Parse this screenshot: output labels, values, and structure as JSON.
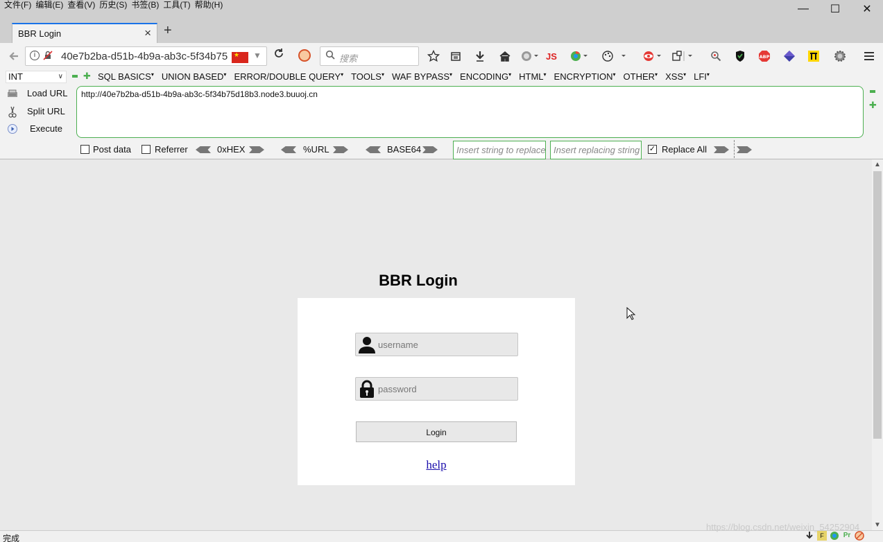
{
  "menubar": {
    "items": [
      "文件(F)",
      "编辑(E)",
      "查看(V)",
      "历史(S)",
      "书签(B)",
      "工具(T)",
      "帮助(H)"
    ]
  },
  "window": {
    "minimize": "—",
    "maximize": "☐",
    "close": "✕"
  },
  "tab": {
    "title": "BBR Login",
    "close": "×",
    "new_tab": "+"
  },
  "navbar": {
    "url": "40e7b2ba-d51b-4b9a-ab3c-5f34b75",
    "search_placeholder": "搜索",
    "icons": [
      "star-icon",
      "reader-icon",
      "download-icon",
      "home-icon",
      "earth-icon",
      "js-icon",
      "chrome-icon",
      "palette-icon",
      "eye-icon",
      "plugin-icon",
      "search-ext-icon",
      "shield-icon",
      "abp-icon",
      "diamond-icon",
      "pi-icon",
      "gear-icon",
      "menu-icon"
    ],
    "js_label": "JS",
    "abp_label": "ABP"
  },
  "hackbar": {
    "select_value": "INT",
    "menus": [
      "SQL BASICS",
      "UNION BASED",
      "ERROR/DOUBLE QUERY",
      "TOOLS",
      "WAF BYPASS",
      "ENCODING",
      "HTML",
      "ENCRYPTION",
      "OTHER",
      "XSS",
      "LFI"
    ],
    "load_url": "Load URL",
    "split_url": "Split URL",
    "execute": "Execute",
    "url_value": "http://40e7b2ba-d51b-4b9a-ab3c-5f34b75d18b3.node3.buuoj.cn",
    "post_data": "Post data",
    "referrer": "Referrer",
    "hex": "0xHEX",
    "percent_url": "%URL",
    "base64": "BASE64",
    "replace_from_placeholder": "Insert string to replace",
    "replace_to_placeholder": "Insert replacing string",
    "replace_all": "Replace All",
    "replace_all_checked": true
  },
  "page": {
    "title": "BBR Login",
    "username_placeholder": "username",
    "password_placeholder": "password",
    "login_button": "Login",
    "help_link": "help"
  },
  "status": {
    "text": "完成",
    "watermark": "https://blog.csdn.net/weixin_54252904"
  }
}
